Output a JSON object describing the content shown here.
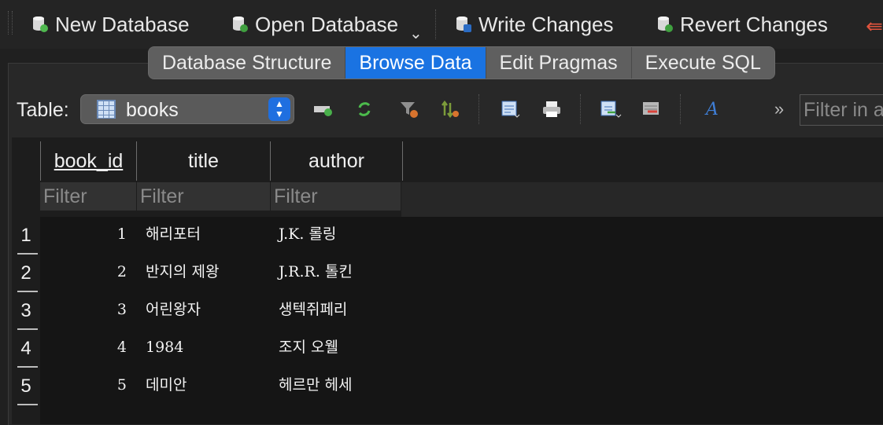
{
  "toolbar": {
    "new_db": "New Database",
    "open_db": "Open Database",
    "write": "Write Changes",
    "revert": "Revert Changes",
    "colors": {
      "new_badge": "#4fb84f",
      "open_badge": "#3f9f3f",
      "write_badge": "#2b6cc4",
      "revert_badge": "#3fa03f"
    }
  },
  "tabs": [
    "Database Structure",
    "Browse Data",
    "Edit Pragmas",
    "Execute SQL"
  ],
  "active_tab": "Browse Data",
  "table_selector": {
    "label": "Table:",
    "value": "books"
  },
  "filter_all": {
    "placeholder": "Filter in a"
  },
  "grid": {
    "columns": [
      "book_id",
      "title",
      "author"
    ],
    "filter_placeholder": "Filter",
    "row_numbers": [
      "1",
      "2",
      "3",
      "4",
      "5"
    ],
    "rows": [
      {
        "book_id": "1",
        "title": "해리포터",
        "author": "J.K. 롤링"
      },
      {
        "book_id": "2",
        "title": "반지의 제왕",
        "author": "J.R.R. 톨킨"
      },
      {
        "book_id": "3",
        "title": "어린왕자",
        "author": "생텍쥐페리"
      },
      {
        "book_id": "4",
        "title": "1984",
        "author": "조지 오웰"
      },
      {
        "book_id": "5",
        "title": "데미안",
        "author": "헤르만 헤세"
      }
    ]
  },
  "accent": "#1a73e2"
}
